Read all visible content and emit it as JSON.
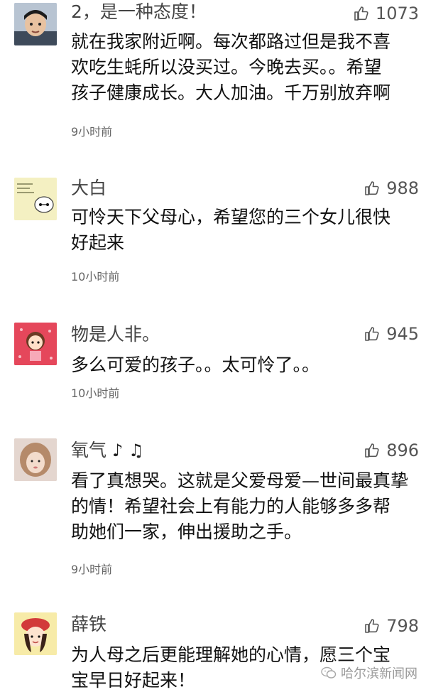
{
  "comments": [
    {
      "username": "2，是一种态度！",
      "likes": "1073",
      "lines": [
        "就在我家附近啊。每次都路过但是我不喜",
        "欢吃生蚝所以没买过。今晚去买。。希望",
        "孩子健康成长。大人加油。千万别放弃啊"
      ],
      "time": "9小时前",
      "avatar": "avatar-boy"
    },
    {
      "username": "大白",
      "likes": "988",
      "lines": [
        "可怜天下父母心，希望您的三个女儿很快",
        "好起来"
      ],
      "time": "10小时前",
      "avatar": "avatar-baymax"
    },
    {
      "username": "物是人非。",
      "likes": "945",
      "lines": [
        "多么可爱的孩子。。太可怜了。。"
      ],
      "time": "10小时前",
      "avatar": "avatar-cartoon-girl"
    },
    {
      "username": "氧气",
      "username_suffix": "♪ ♫",
      "likes": "896",
      "lines": [
        "看了真想哭。这就是父爱母爱—世间最真挚",
        "的情！希望社会上有能力的人能够多多帮",
        "助她们一家，伸出援助之手。"
      ],
      "time": "9小时前",
      "avatar": "avatar-photo-girl"
    },
    {
      "username": "薛铁",
      "likes": "798",
      "lines": [
        "为人母之后更能理解她的心情，愿三个宝",
        "宝早日好起来！"
      ],
      "time": "",
      "avatar": "avatar-red-hat-girl"
    }
  ],
  "watermark": "哈尔滨新闻网",
  "colors": {
    "text": "#111111",
    "meta": "#666666",
    "like": "#555555"
  },
  "icons": {
    "like": "thumbs-up-icon",
    "watermark": "wechat-icon"
  }
}
